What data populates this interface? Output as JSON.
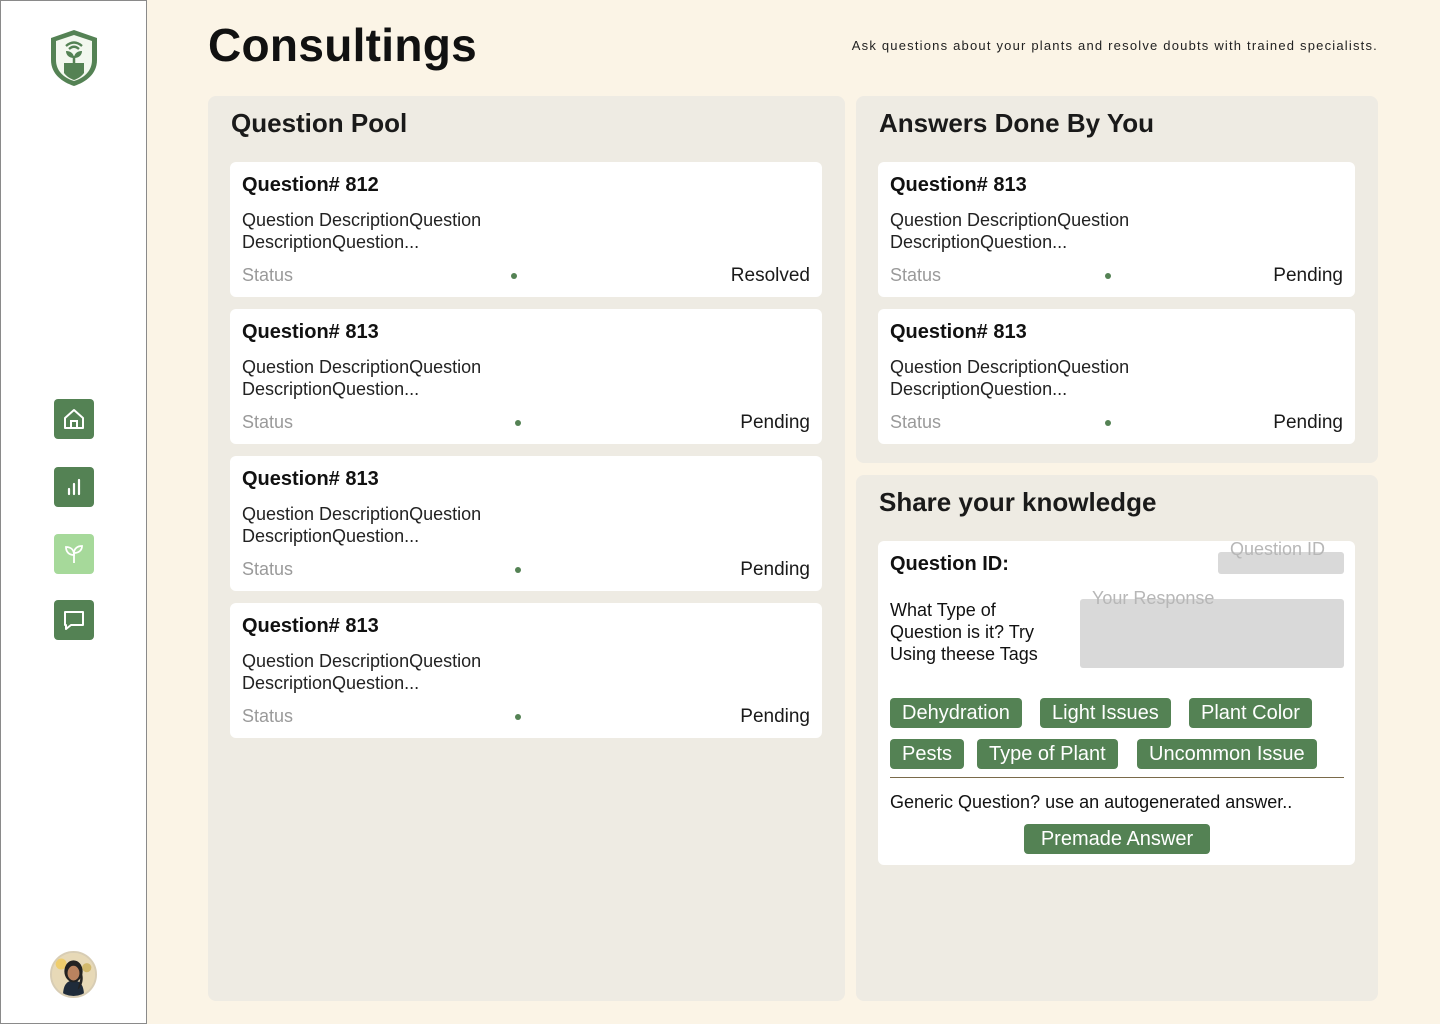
{
  "header": {
    "title": "Consultings",
    "subtitle": "Ask questions about your plants and resolve doubts with trained specialists."
  },
  "sidebar": {
    "nav": [
      {
        "icon": "home-icon",
        "state": "default"
      },
      {
        "icon": "chart-icon",
        "state": "default"
      },
      {
        "icon": "plant-icon",
        "state": "active"
      },
      {
        "icon": "chat-icon",
        "state": "default"
      }
    ]
  },
  "question_pool": {
    "title": "Question Pool",
    "items": [
      {
        "title": "Question# 812",
        "desc": "Question DescriptionQuestion DescriptionQuestion...",
        "status_label": "Status",
        "status": "Resolved"
      },
      {
        "title": "Question# 813",
        "desc": "Question DescriptionQuestion DescriptionQuestion...",
        "status_label": "Status",
        "status": "Pending"
      },
      {
        "title": "Question# 813",
        "desc": "Question DescriptionQuestion DescriptionQuestion...",
        "status_label": "Status",
        "status": "Pending"
      },
      {
        "title": "Question# 813",
        "desc": "Question DescriptionQuestion DescriptionQuestion...",
        "status_label": "Status",
        "status": "Pending"
      }
    ]
  },
  "answers": {
    "title": "Answers Done By You",
    "items": [
      {
        "title": "Question# 813",
        "desc": "Question DescriptionQuestion DescriptionQuestion...",
        "status_label": "Status",
        "status": "Pending"
      },
      {
        "title": "Question# 813",
        "desc": "Question DescriptionQuestion DescriptionQuestion...",
        "status_label": "Status",
        "status": "Pending"
      }
    ]
  },
  "share": {
    "title": "Share your knowledge",
    "question_id_label": "Question ID:",
    "question_id_placeholder": "Question ID",
    "type_question": "What Type of Question is it? Try Using theese Tags",
    "response_placeholder": "Your Response",
    "tags": [
      "Dehydration",
      "Light Issues",
      "Plant Color",
      "Pests",
      "Type of Plant",
      "Uncommon Issue"
    ],
    "generic_text": "Generic Question? use an autogenerated answer..",
    "premade_button": "Premade Answer"
  },
  "colors": {
    "accent": "#548254",
    "accent_light": "#a6d99a",
    "page_bg": "#fbf4e6",
    "panel_bg": "#eeebe3"
  }
}
